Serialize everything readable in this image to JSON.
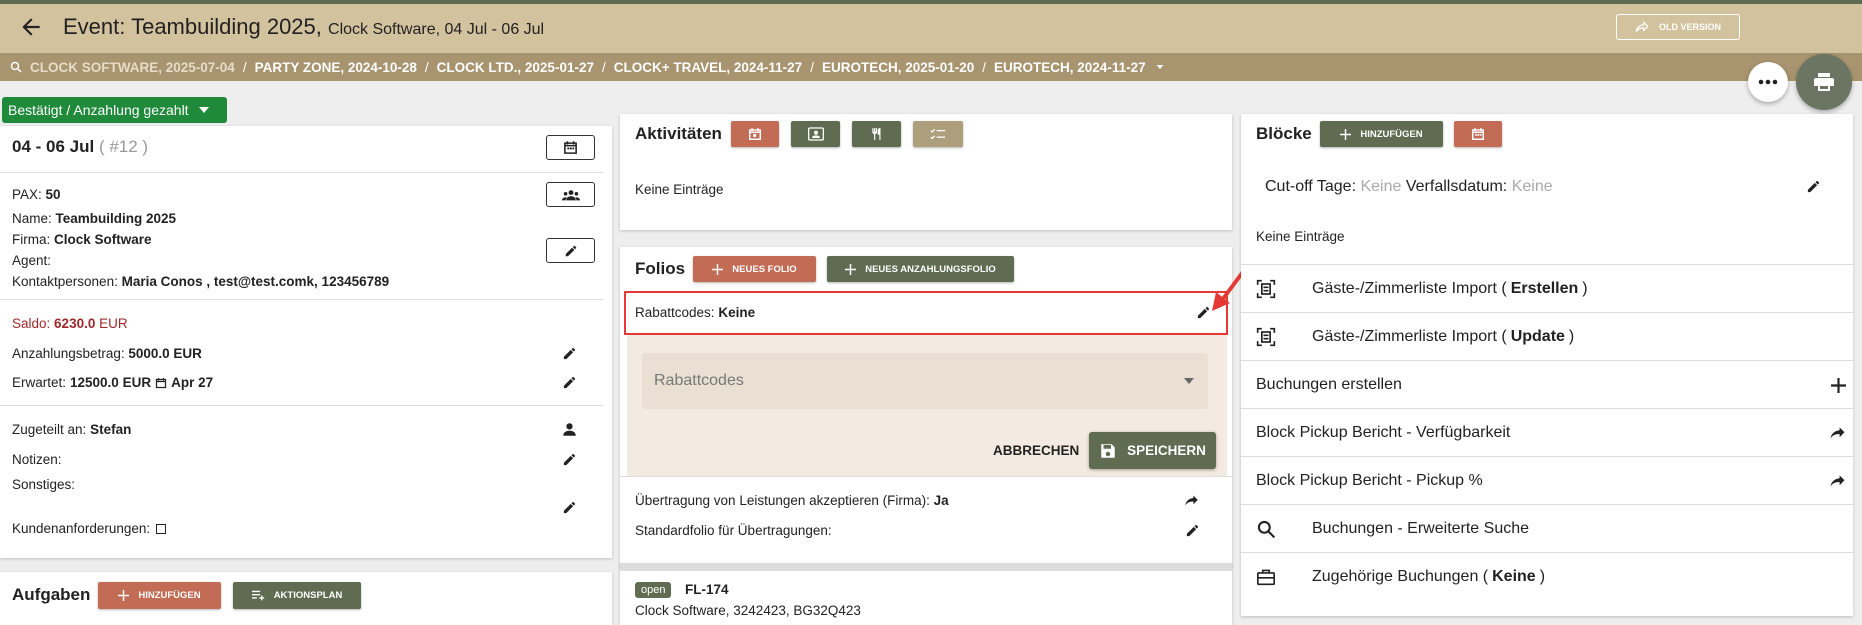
{
  "header": {
    "title": "Event: Teambuilding 2025,",
    "subtitle": "Clock Software, 04 Jul - 06 Jul",
    "old_version": "OLD VERSION"
  },
  "breadcrumbs": [
    "CLOCK SOFTWARE, 2025-07-04",
    "PARTY ZONE, 2024-10-28",
    "CLOCK LTD., 2025-01-27",
    "CLOCK+ TRAVEL, 2024-11-27",
    "EUROTECH, 2025-01-20",
    "EUROTECH, 2024-11-27"
  ],
  "status": "Bestätigt / Anzahlung gezahlt",
  "left": {
    "dates": "04 - 06 Jul",
    "num": "( #12 )",
    "pax_label": "PAX:",
    "pax": "50",
    "name_label": "Name:",
    "name": "Teambuilding 2025",
    "firma_label": "Firma:",
    "firma": "Clock Software",
    "agent_label": "Agent:",
    "kontakt_label": "Kontaktpersonen:",
    "kontakt": "Maria Conos , test@test.comk, 123456789",
    "saldo_label": "Saldo:",
    "saldo": "6230.0",
    "saldo_cur": "EUR",
    "anz_label": "Anzahlungsbetrag:",
    "anz": "5000.0 EUR",
    "erw_label": "Erwartet:",
    "erw": "12500.0 EUR",
    "erw_date": "Apr 27",
    "zug_label": "Zugeteilt an:",
    "zug": "Stefan",
    "notizen_label": "Notizen:",
    "sonst_label": "Sonstiges:",
    "kunden_label": "Kundenanforderungen:"
  },
  "aufgaben": {
    "title": "Aufgaben",
    "add": "HINZUFÜGEN",
    "plan": "AKTIONSPLAN"
  },
  "aktivitaeten": {
    "title": "Aktivitäten",
    "empty": "Keine Einträge"
  },
  "folios": {
    "title": "Folios",
    "new": "NEUES FOLIO",
    "new_dep": "NEUES ANZAHLUNGSFOLIO",
    "rabatt_label": "Rabattcodes:",
    "rabatt_value": "Keine",
    "select_placeholder": "Rabattcodes",
    "cancel": "ABBRECHEN",
    "save": "SPEICHERN",
    "transfer_label": "Übertragung von Leistungen akzeptieren (Firma):",
    "transfer_value": "Ja",
    "standard_label": "Standardfolio für Übertragungen:",
    "folio_badge": "open",
    "folio_id": "FL-174",
    "folio_desc": "Clock Software, 3242423, BG32Q423"
  },
  "bloecke": {
    "title": "Blöcke",
    "add": "HINZUFÜGEN",
    "cutoff_label": "Cut-off Tage:",
    "cutoff": "Keine",
    "verfall_label": "Verfallsdatum:",
    "verfall": "Keine",
    "empty": "Keine Einträge",
    "import_create_pre": "Gäste-/Zimmerliste Import (",
    "import_create_b": "Erstellen",
    "import_create_post": ")",
    "import_update_pre": "Gäste-/Zimmerliste Import (",
    "import_update_b": "Update",
    "import_update_post": ")",
    "buchungen_erstellen": "Buchungen erstellen",
    "pickup_verf": "Block Pickup Bericht - Verfügbarkeit",
    "pickup_pct": "Block Pickup Bericht - Pickup %",
    "erweiterte_suche": "Buchungen - Erweiterte Suche",
    "zug_pre": "Zugehörige Buchungen (",
    "zug_b": "Keine",
    "zug_post": ")"
  },
  "colors": {
    "header_bg": "#d3c29e",
    "crumb_bg": "#a8946f",
    "status_green": "#1f8a3a",
    "btn_red": "#c26b55",
    "btn_green": "#5f6c52",
    "btn_tan": "#ad9f7c",
    "highlight": "#e53935",
    "saldo": "#a0282a"
  }
}
